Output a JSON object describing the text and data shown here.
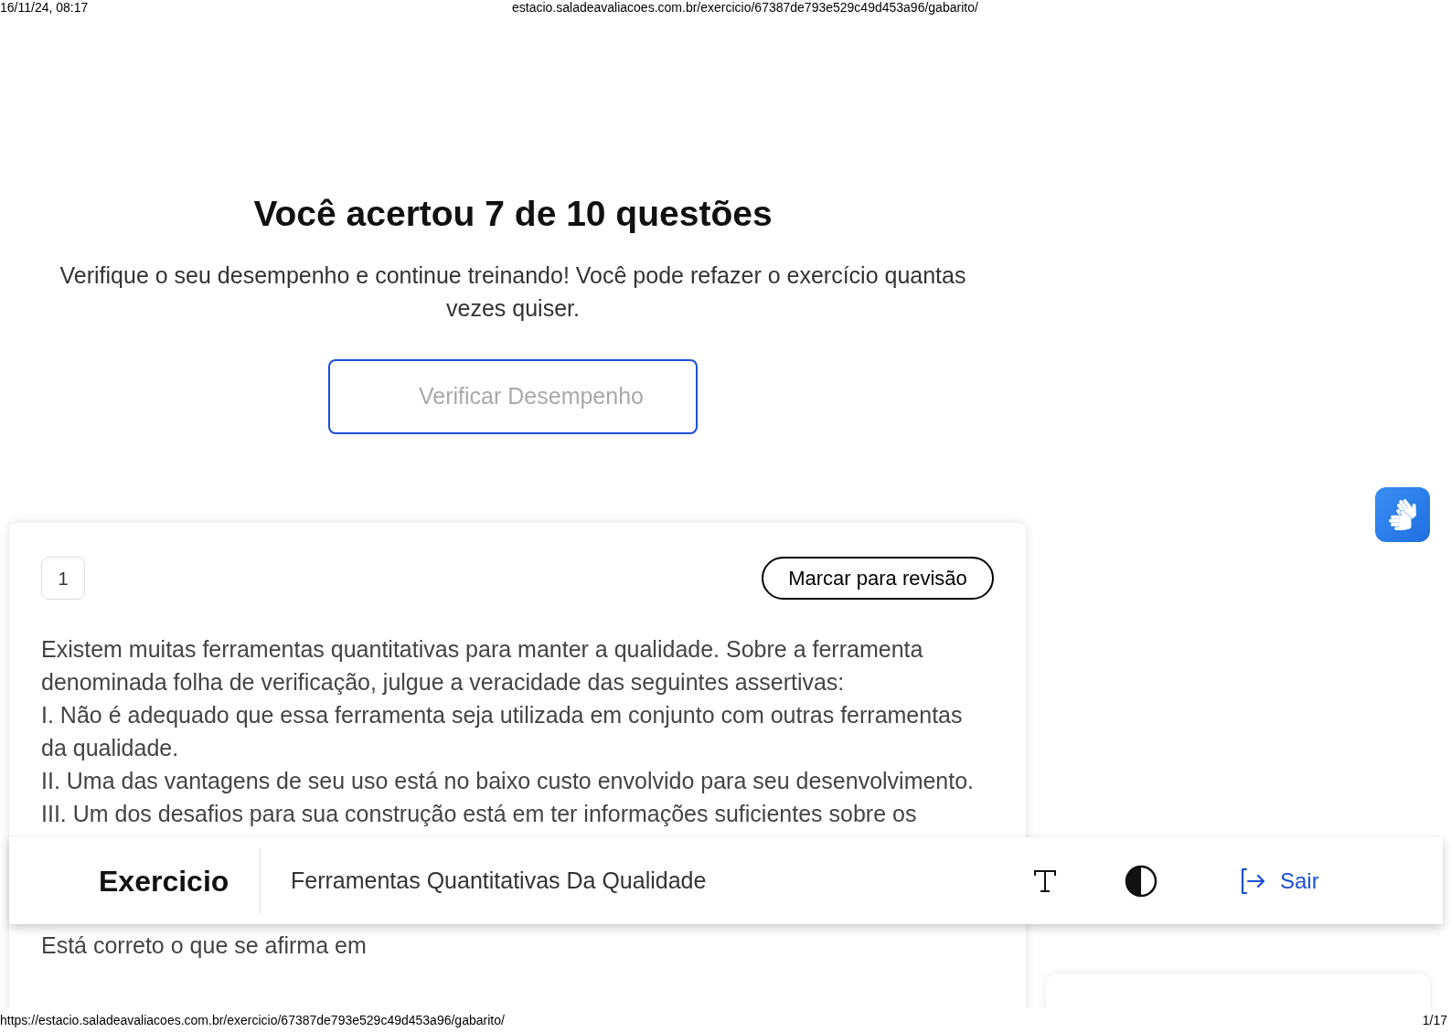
{
  "print_header": {
    "date": "16/11/24, 08:17",
    "url": "estacio.saladeavaliacoes.com.br/exercicio/67387de793e529c49d453a96/gabarito/"
  },
  "result": {
    "title": "Você acertou 7 de 10 questões",
    "subtitle": "Verifique o seu desempenho e continue treinando! Você pode refazer o exercício quantas vezes quiser.",
    "button": "Verificar Desempenho"
  },
  "question": {
    "number": "1",
    "review_button": "Marcar para revisão",
    "lines": [
      "Existem muitas ferramentas quantitativas para manter a qualidade. Sobre a ferramenta",
      "denominada folha de verificação, julgue a veracidade das seguintes assertivas:",
      "I. Não é adequado que essa ferramenta seja utilizada em conjunto com outras ferramentas",
      "da qualidade.",
      "II. Uma das vantagens de seu uso está no baixo custo envolvido para seu desenvolvimento.",
      "III. Um dos desafios para sua construção está em ter informações suficientes sobre os"
    ],
    "prompt": "Está correto o que se afirma em"
  },
  "toolbar": {
    "title": "Exercicio",
    "subject": "Ferramentas Quantitativas Da Qualidade",
    "exit": "Sair"
  },
  "print_footer": {
    "url": "https://estacio.saladeavaliacoes.com.br/exercicio/67387de793e529c49d453a96/gabarito/",
    "page": "1/17"
  }
}
